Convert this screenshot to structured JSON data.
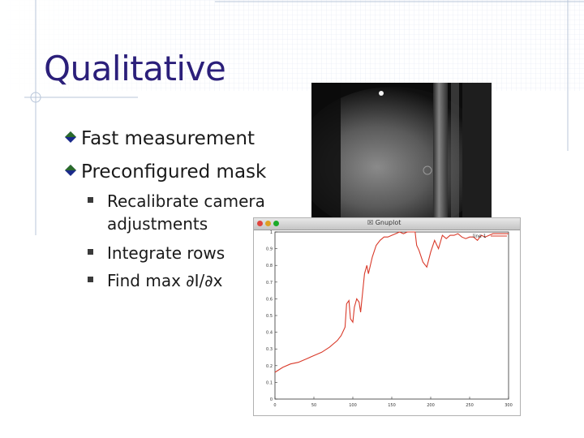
{
  "slide": {
    "title": "Qualitative",
    "bullets": [
      "Fast measurement",
      "Preconfigured mask"
    ],
    "sub_bullets": [
      "Recalibrate camera adjustments",
      "Integrate rows",
      "Find max ∂I/∂x"
    ],
    "colors": {
      "title": "#2b1f7a",
      "diamond_top": "#2a6b2a",
      "diamond_bottom": "#1a2a8a",
      "plot_line": "#d93a2a"
    }
  },
  "gnuplot": {
    "window_title": "Gnuplot",
    "close_icon": "close-icon",
    "legend": "line 1"
  },
  "chart_data": {
    "type": "line",
    "x_ticks": [
      "0",
      "50",
      "100",
      "150",
      "200",
      "250",
      "300"
    ],
    "y_ticks": [
      "0",
      "0.1",
      "0.2",
      "0.3",
      "0.4",
      "0.5",
      "0.6",
      "0.7",
      "0.8",
      "0.9",
      "1"
    ],
    "xlim": [
      0,
      300
    ],
    "ylim": [
      0,
      1
    ],
    "series": [
      {
        "name": "line 1",
        "x": [
          0,
          10,
          20,
          30,
          40,
          50,
          60,
          70,
          80,
          85,
          90,
          92,
          95,
          97,
          100,
          102,
          105,
          108,
          110,
          115,
          118,
          120,
          125,
          130,
          135,
          140,
          145,
          150,
          155,
          160,
          165,
          170,
          175,
          180,
          182,
          185,
          190,
          195,
          200,
          205,
          210,
          215,
          220,
          225,
          230,
          235,
          240,
          245,
          250,
          255,
          260,
          265,
          270,
          280,
          290,
          300
        ],
        "y": [
          0.16,
          0.19,
          0.21,
          0.22,
          0.24,
          0.26,
          0.28,
          0.31,
          0.35,
          0.38,
          0.43,
          0.57,
          0.59,
          0.48,
          0.46,
          0.55,
          0.6,
          0.58,
          0.52,
          0.75,
          0.8,
          0.75,
          0.85,
          0.92,
          0.95,
          0.97,
          0.97,
          0.98,
          0.99,
          1.0,
          0.99,
          1.0,
          1.0,
          1.0,
          0.92,
          0.89,
          0.82,
          0.79,
          0.88,
          0.95,
          0.9,
          0.98,
          0.96,
          0.98,
          0.98,
          0.99,
          0.97,
          0.96,
          0.97,
          0.97,
          0.95,
          0.98,
          0.97,
          0.99,
          0.99,
          0.99
        ]
      }
    ]
  }
}
